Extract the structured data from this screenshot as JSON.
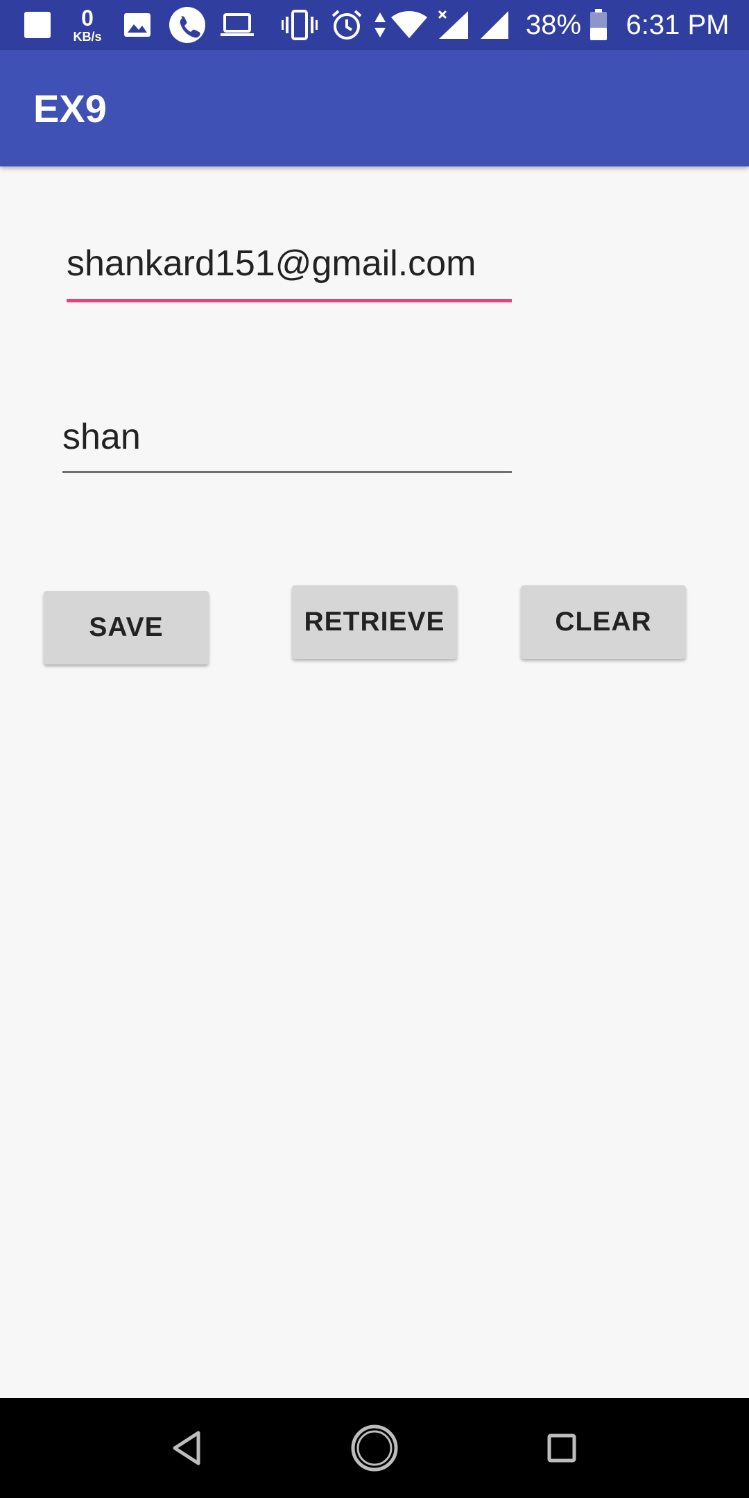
{
  "status_bar": {
    "net_speed_value": "0",
    "net_speed_unit": "KB/s",
    "battery_percent": "38%",
    "time": "6:31 PM",
    "icons": [
      "notification-square-icon",
      "image-icon",
      "phone-icon",
      "laptop-icon",
      "vibrate-icon",
      "alarm-icon",
      "data-arrows-icon",
      "wifi-icon",
      "signal-no-data-icon",
      "signal-icon",
      "battery-icon"
    ]
  },
  "app_bar": {
    "title": "EX9"
  },
  "form": {
    "email_value": "shankard151@gmail.com",
    "password_value": "shan"
  },
  "buttons": {
    "save_label": "SAVE",
    "retrieve_label": "RETRIEVE",
    "clear_label": "CLEAR"
  },
  "nav_bar": {
    "icons": [
      "back-icon",
      "home-icon",
      "recents-icon"
    ]
  },
  "colors": {
    "status_bar": "#303f9f",
    "app_bar": "#3f51b5",
    "accent": "#ec407a",
    "button": "#d6d6d6",
    "background": "#f7f7f7"
  }
}
